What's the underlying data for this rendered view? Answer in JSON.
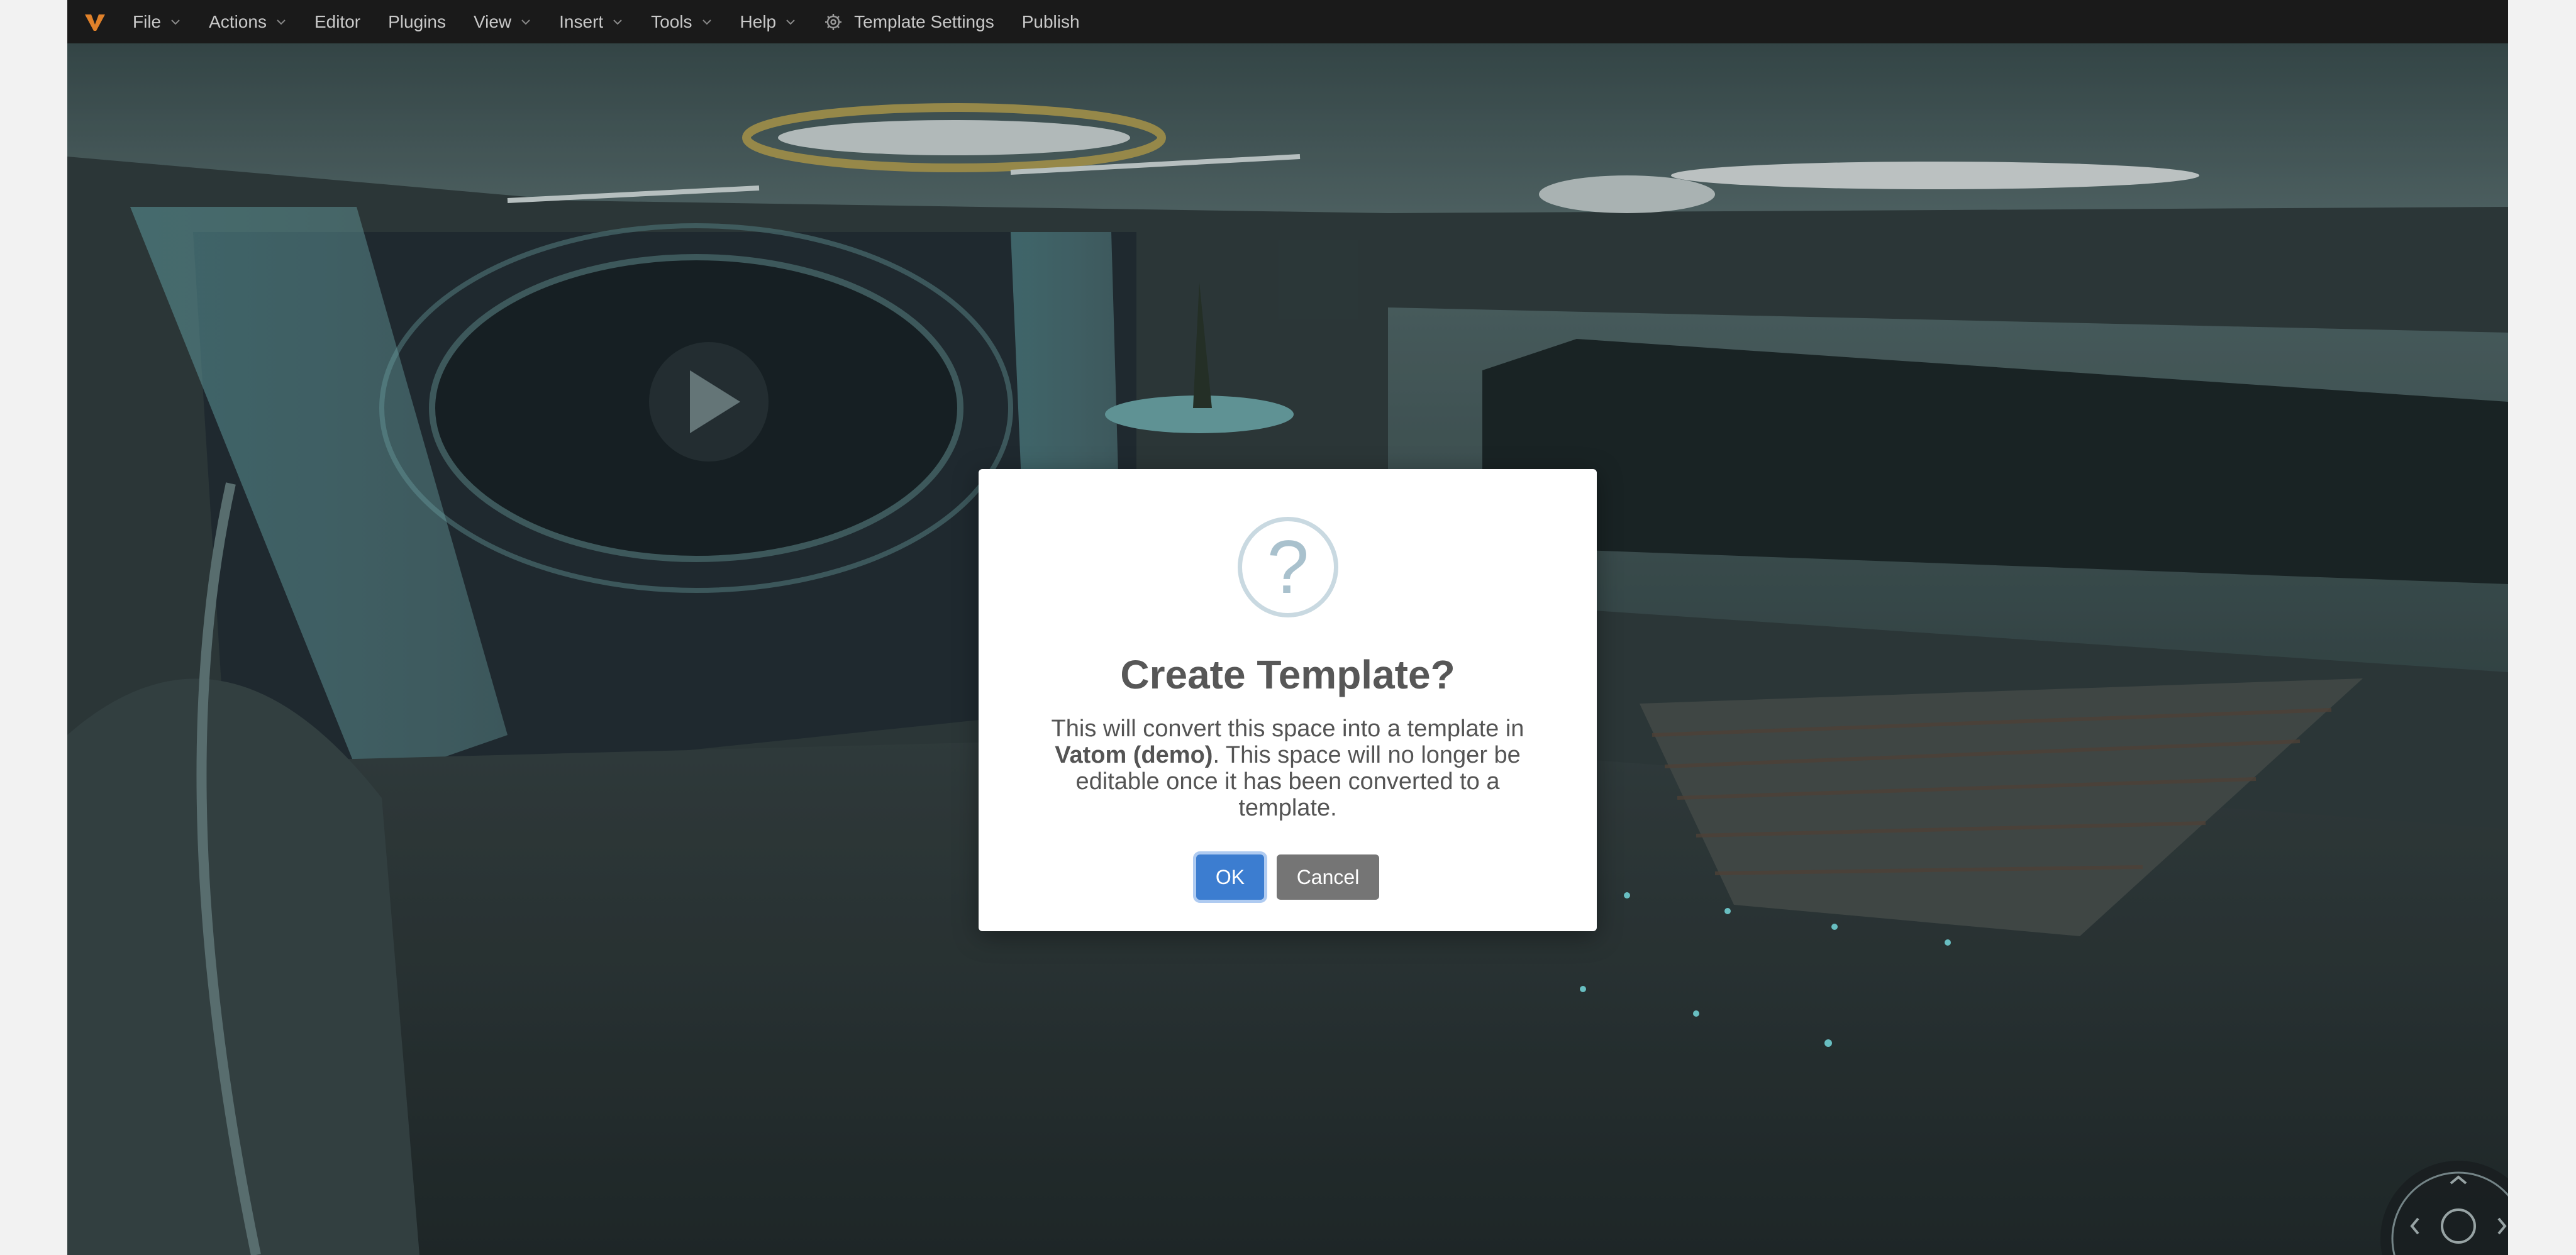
{
  "menubar": {
    "logo_icon": "vatom-logo-icon",
    "accent_color": "#e0812a",
    "items": [
      {
        "label": "File",
        "has_dropdown": true
      },
      {
        "label": "Actions",
        "has_dropdown": true
      },
      {
        "label": "Editor",
        "has_dropdown": false
      },
      {
        "label": "Plugins",
        "has_dropdown": false
      },
      {
        "label": "View",
        "has_dropdown": true
      },
      {
        "label": "Insert",
        "has_dropdown": true
      },
      {
        "label": "Tools",
        "has_dropdown": true
      },
      {
        "label": "Help",
        "has_dropdown": true
      }
    ],
    "template_settings_label": "Template Settings",
    "publish_label": "Publish"
  },
  "dialog": {
    "icon": "question-mark-icon",
    "icon_glyph": "?",
    "title": "Create Template?",
    "message_before": "This will convert this space into a template in ",
    "message_bold": "Vatom (demo)",
    "message_after": ". This space will no longer be editable once it has been converted to a template.",
    "ok_label": "OK",
    "cancel_label": "Cancel",
    "ok_color": "#3c7dd0",
    "cancel_color": "#757575"
  },
  "joystick": {
    "icons": [
      "chevron-up-icon",
      "chevron-left-icon",
      "chevron-right-icon",
      "circle-icon"
    ]
  }
}
